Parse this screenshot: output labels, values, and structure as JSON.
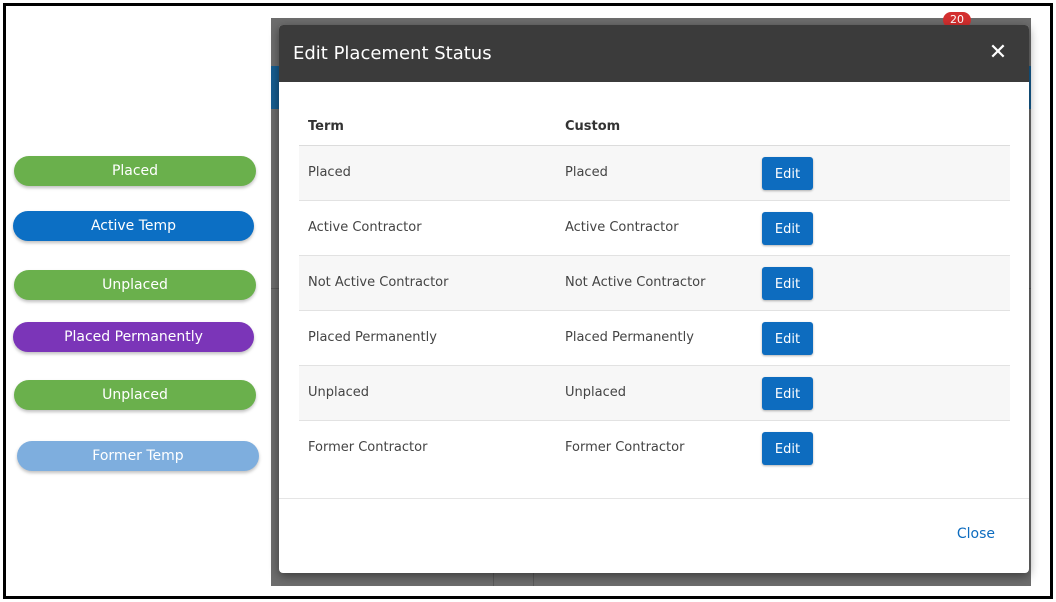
{
  "status_pills": [
    {
      "label": "Placed",
      "color": "#6ab04c"
    },
    {
      "label": "Active Temp",
      "color": "#0c6fc4"
    },
    {
      "label": "Unplaced",
      "color": "#6ab04c"
    },
    {
      "label": "Placed Permanently",
      "color": "#7b35b8"
    },
    {
      "label": "Unplaced",
      "color": "#6ab04c"
    },
    {
      "label": "Former Temp",
      "color": "#7eaede"
    }
  ],
  "background": {
    "badge_count": "20"
  },
  "modal": {
    "title": "Edit Placement Status",
    "close_icon": "close-icon",
    "columns": {
      "term": "Term",
      "custom": "Custom"
    },
    "rows": [
      {
        "term": "Placed",
        "custom": "Placed",
        "action": "Edit"
      },
      {
        "term": "Active Contractor",
        "custom": "Active Contractor",
        "action": "Edit"
      },
      {
        "term": "Not Active Contractor",
        "custom": "Not Active Contractor",
        "action": "Edit"
      },
      {
        "term": "Placed Permanently",
        "custom": "Placed Permanently",
        "action": "Edit"
      },
      {
        "term": "Unplaced",
        "custom": "Unplaced",
        "action": "Edit"
      },
      {
        "term": "Former Contractor",
        "custom": "Former Contractor",
        "action": "Edit"
      }
    ],
    "footer_close": "Close"
  },
  "colors": {
    "header_bg": "#3b3b3b",
    "button_blue": "#0d6cbf",
    "link_blue": "#0d6cbf"
  }
}
